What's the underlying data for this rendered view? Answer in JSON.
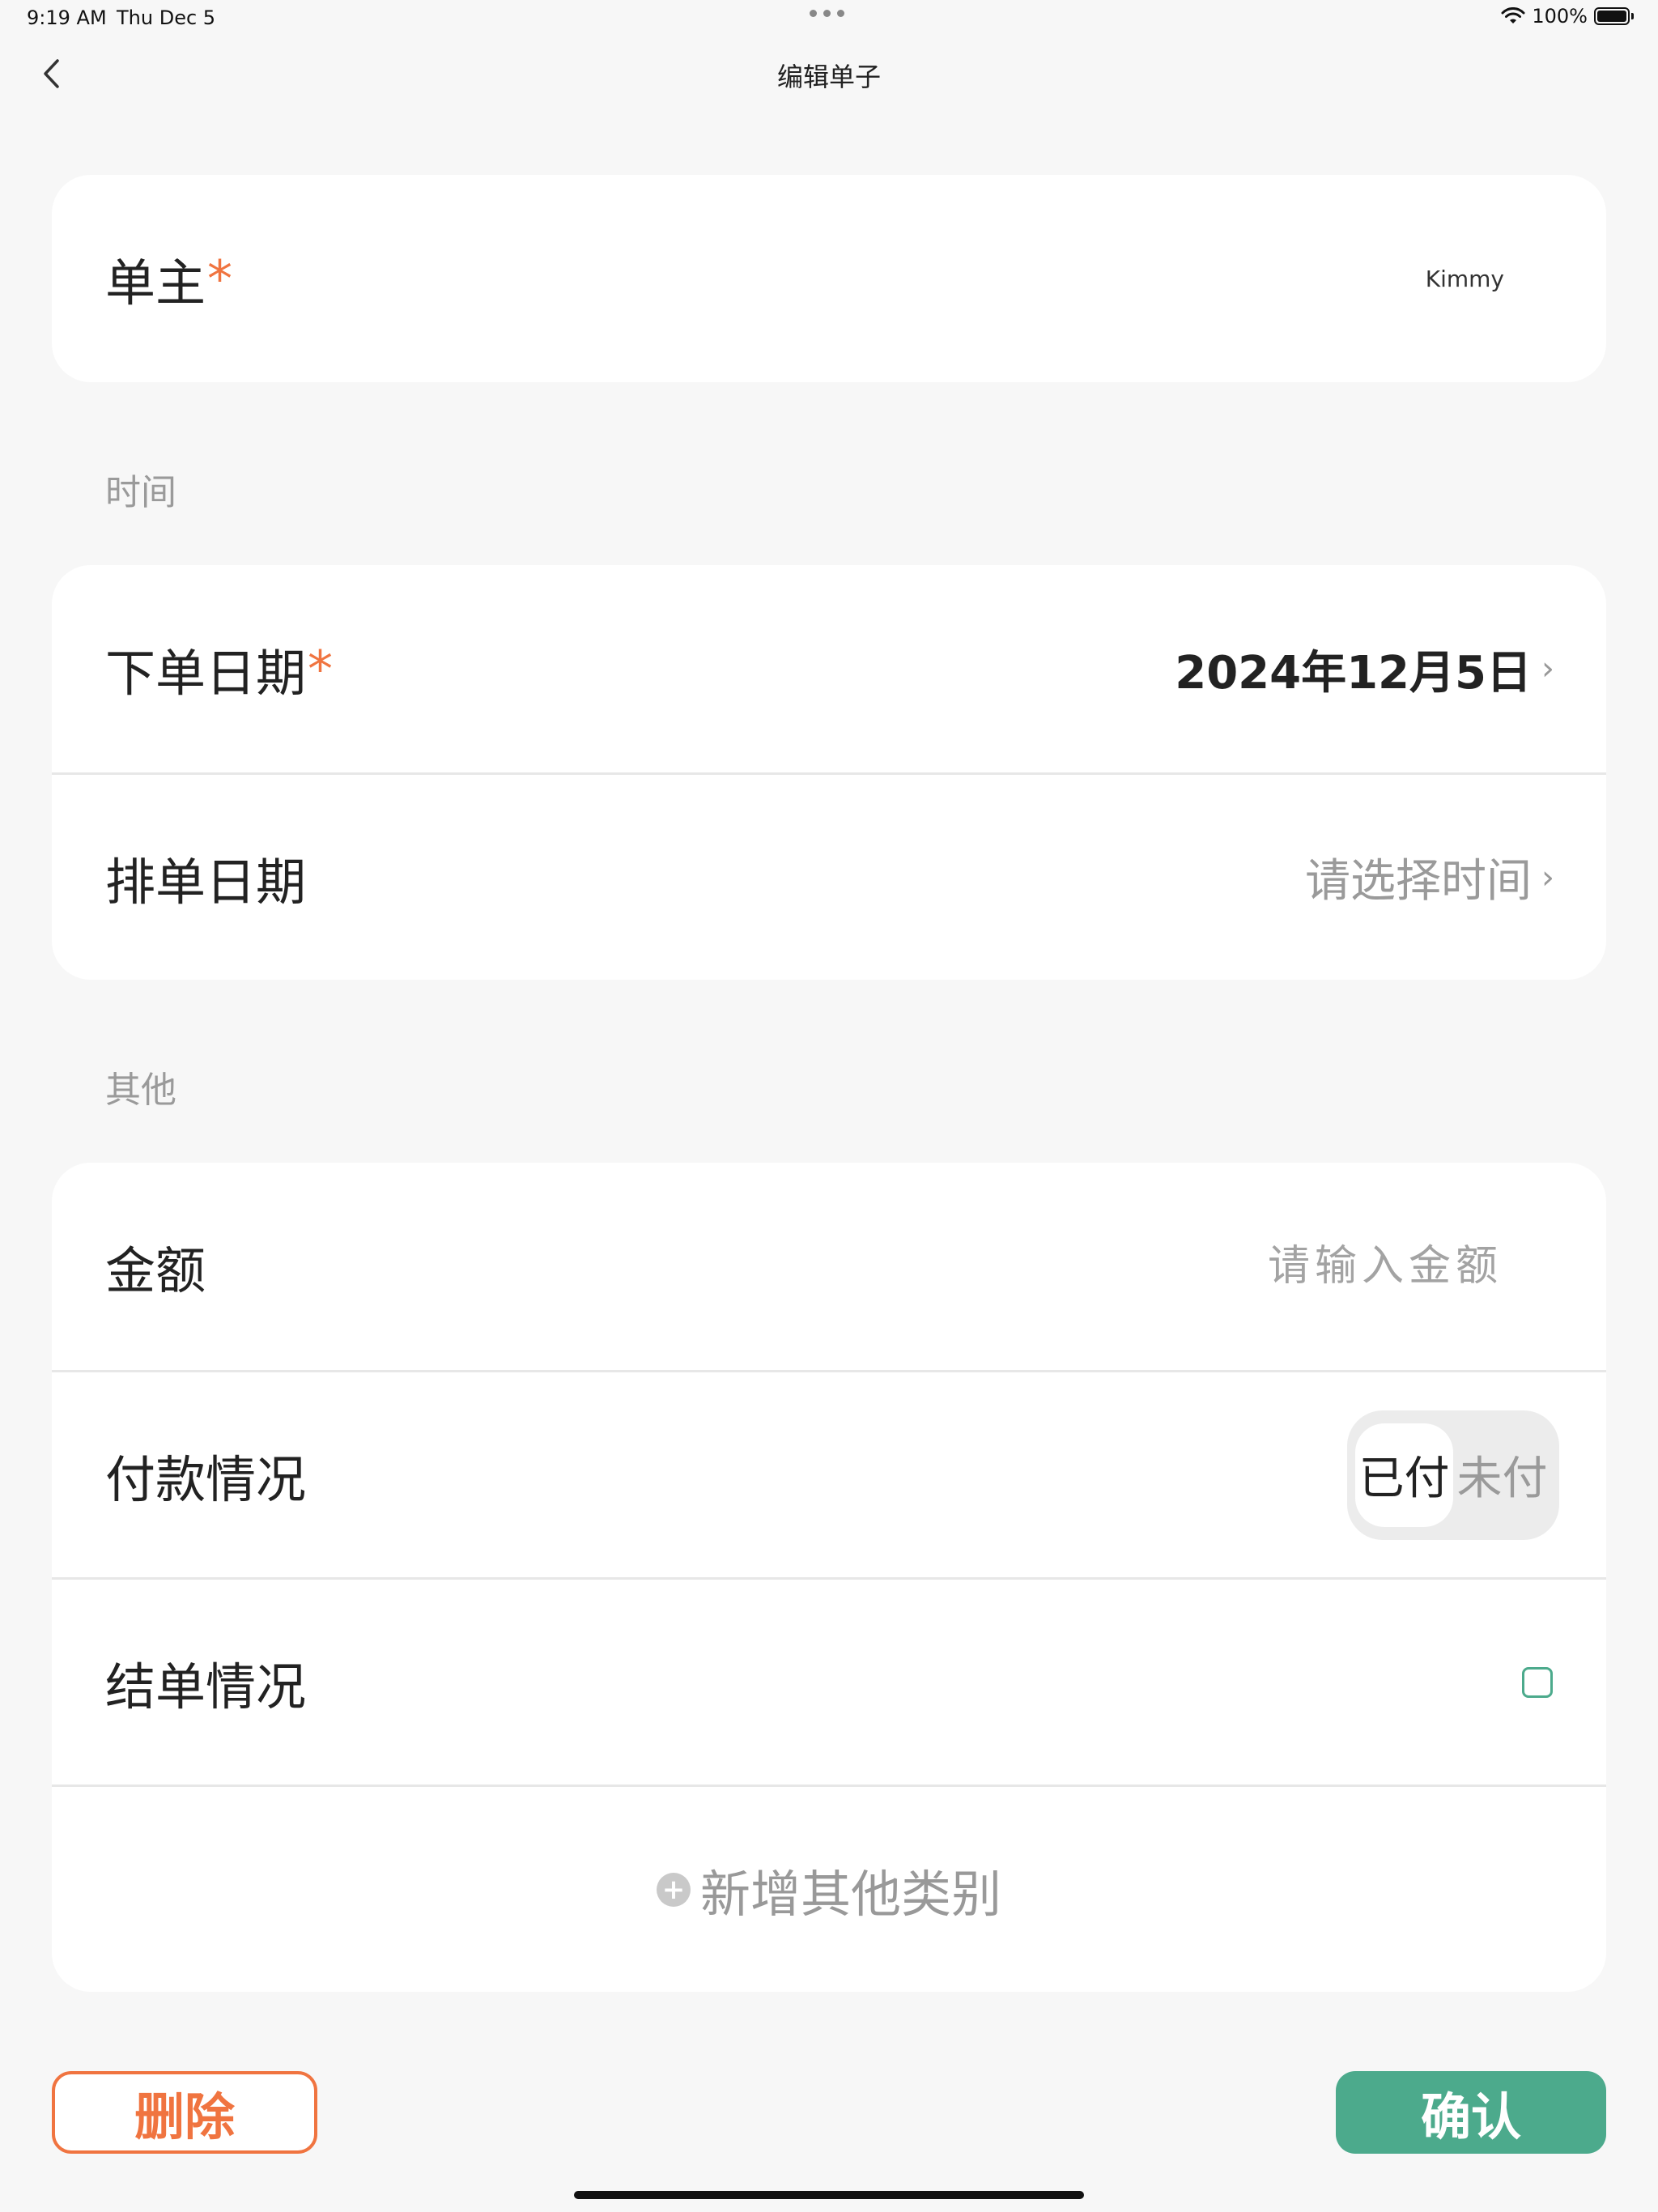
{
  "status_bar": {
    "time": "9:19 AM",
    "date": "Thu Dec 5",
    "battery": "100%"
  },
  "nav": {
    "title": "编辑单子"
  },
  "owner": {
    "label": "单主",
    "required_mark": "*",
    "value": "Kimmy"
  },
  "sections": {
    "time": "时间",
    "other": "其他"
  },
  "order_date": {
    "label": "下单日期",
    "required_mark": "*",
    "value": "2024年12月5日",
    "chevron": "›"
  },
  "schedule_date": {
    "label": "排单日期",
    "placeholder": "请选择时间",
    "chevron": "›"
  },
  "amount": {
    "label": "金额",
    "placeholder": "请输入金额",
    "value": ""
  },
  "payment": {
    "label": "付款情况",
    "options": [
      "已付",
      "未付"
    ],
    "selected": "已付"
  },
  "settlement": {
    "label": "结单情况",
    "checked": false
  },
  "add_category": {
    "label": "新增其他类别",
    "icon": "plus-circle-icon"
  },
  "actions": {
    "delete": "删除",
    "confirm": "确认"
  },
  "colors": {
    "accent_green": "#4caa8c",
    "accent_orange": "#f07440",
    "background": "#f7f7f7"
  }
}
